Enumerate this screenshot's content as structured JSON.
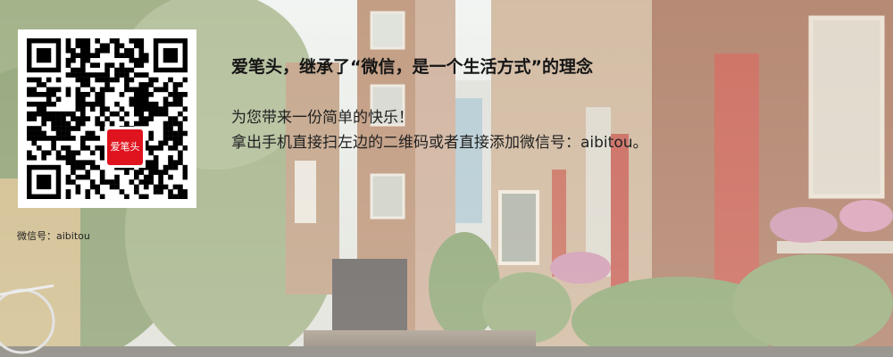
{
  "promo": {
    "headline": "爱笔头，继承了“微信，是一个生活方式”的理念",
    "line1": "为您带来一份简单的快乐！",
    "line2": "拿出手机直接扫左边的二维码或者直接添加微信号：aibitou。",
    "wechat_caption": "微信号：aibitou",
    "qr_logo_text": "爱笔头"
  },
  "colors": {
    "logo_red": "#e0141f",
    "text_dark": "#151515"
  },
  "icons": {
    "qr": "qr-code-icon",
    "logo": "aibitou-logo"
  }
}
